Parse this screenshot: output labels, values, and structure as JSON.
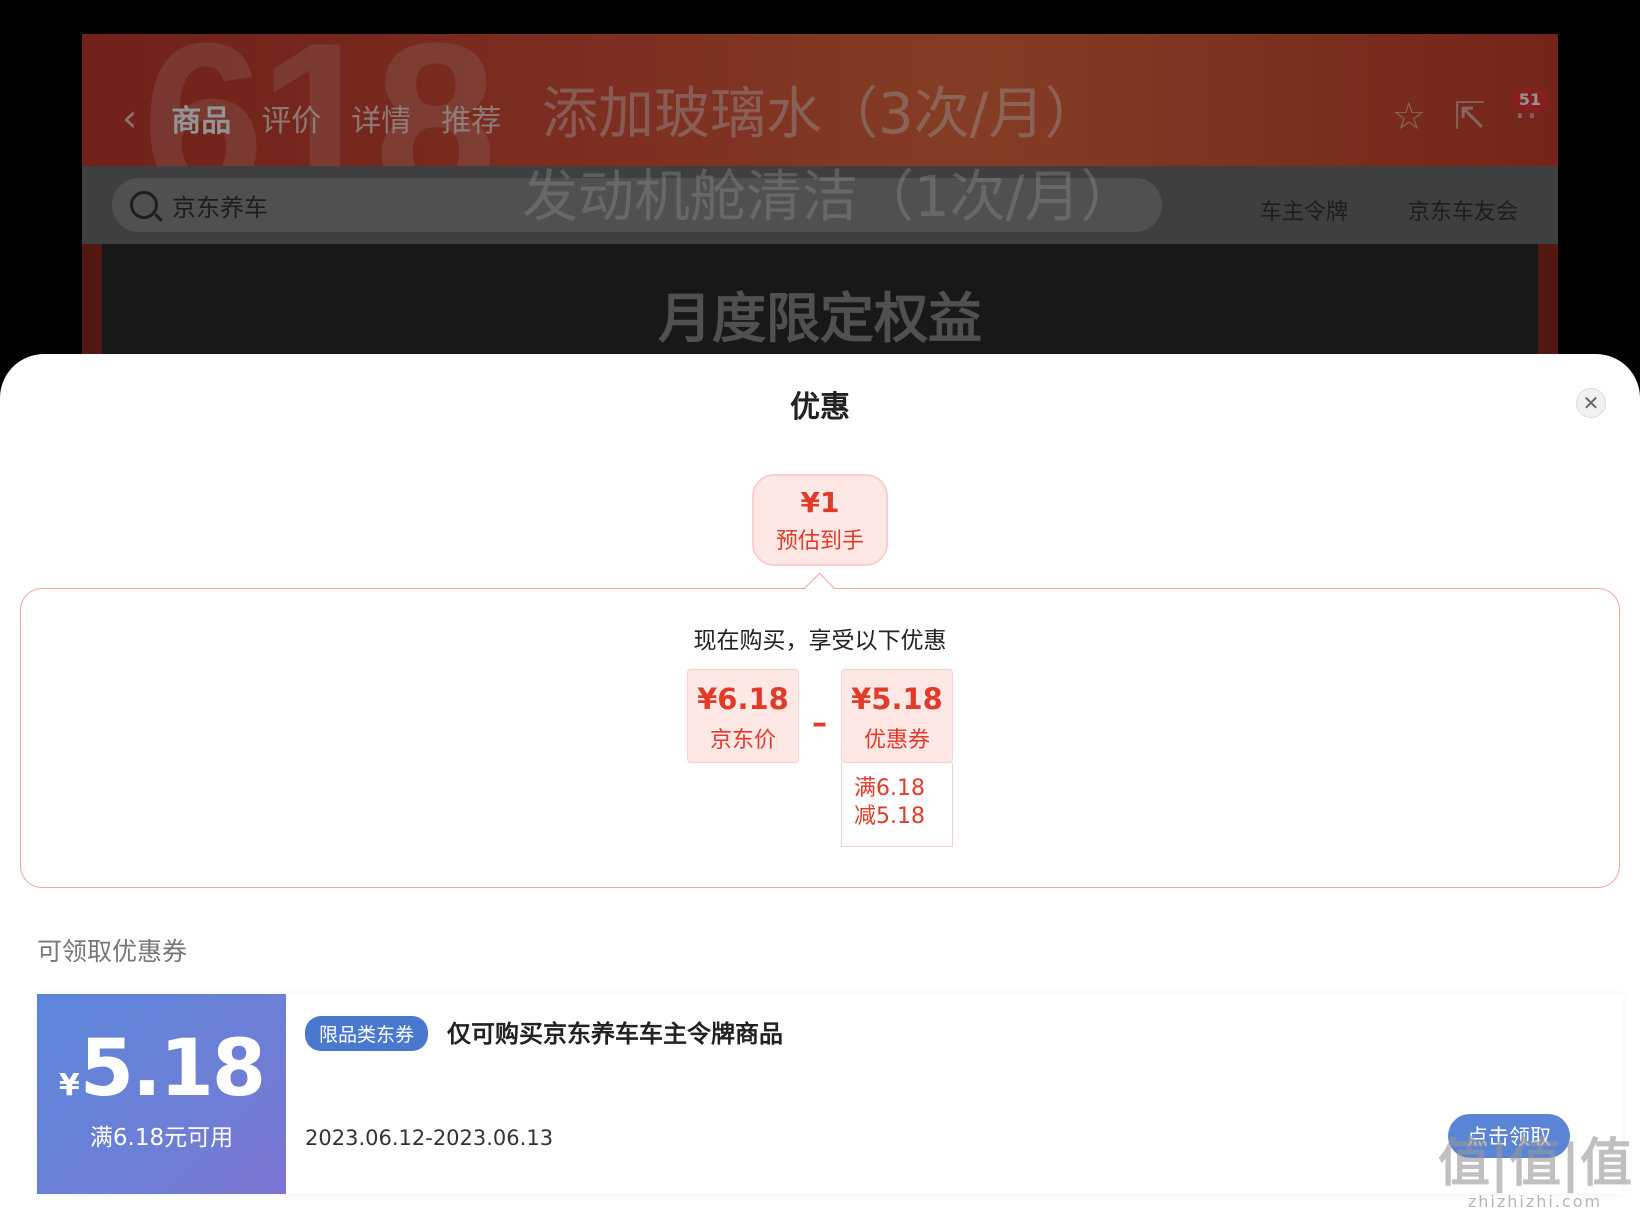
{
  "background": {
    "promo_text": "618",
    "tabs": [
      "商品",
      "评价",
      "详情",
      "推荐"
    ],
    "overlay_title": "添加玻璃水（3次/月）",
    "overlay_sub": "发动机舱清洁（1次/月）",
    "cart_badge": "51",
    "search_placeholder": "京东养车",
    "links": [
      "车主令牌",
      "京东车友会"
    ],
    "section_title": "月度限定权益"
  },
  "sheet": {
    "title": "优惠",
    "estimate": {
      "price": "¥1",
      "label": "预估到手"
    },
    "promo_headline": "现在购买，享受以下优惠",
    "jd_price": {
      "amount": "¥6.18",
      "label": "京东价"
    },
    "operator": "–",
    "coupon_price": {
      "amount": "¥5.18",
      "label": "优惠券"
    },
    "coupon_detail": [
      "满6.18",
      "减5.18"
    ],
    "available_label": "可领取优惠券",
    "coupon": {
      "symbol": "¥",
      "value": "5.18",
      "condition": "满6.18元可用",
      "tag": "限品类东券",
      "description": "仅可购买京东养车车主令牌商品",
      "date_range": "2023.06.12-2023.06.13",
      "claim_label": "点击领取"
    }
  },
  "watermark": {
    "big": "值|值|值",
    "small": "zhizhizhi.com"
  },
  "colors": {
    "accent_red": "#e23b2a",
    "coupon_blue": "#5a84d6"
  }
}
